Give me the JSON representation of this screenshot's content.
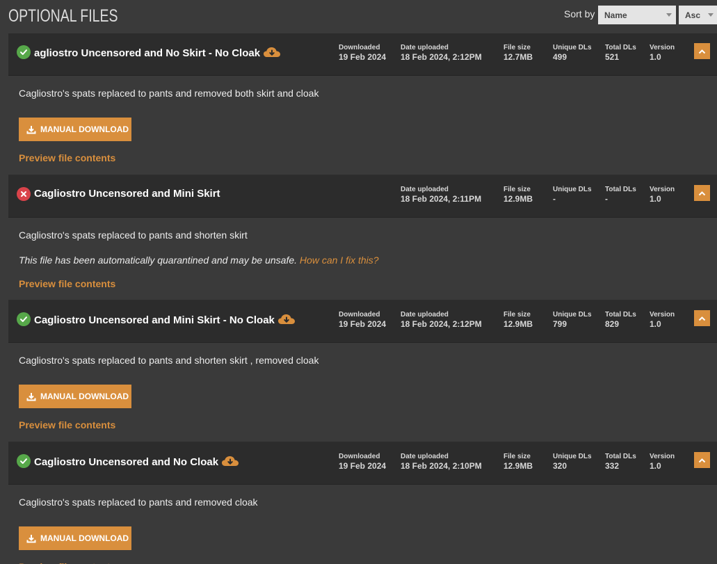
{
  "header": {
    "title": "OPTIONAL FILES",
    "sort_label": "Sort by",
    "sort_field": "Name",
    "sort_order": "Asc"
  },
  "labels": {
    "downloaded": "Downloaded",
    "date_uploaded": "Date uploaded",
    "file_size": "File size",
    "unique_dls": "Unique DLs",
    "total_dls": "Total DLs",
    "version": "Version",
    "manual_download": "MANUAL DOWNLOAD",
    "preview": "Preview file contents",
    "quarantine_text": "This file has been automatically quarantined and may be unsafe.",
    "quarantine_link": "How can I fix this?"
  },
  "colors": {
    "accent": "#d98f3d",
    "ok": "#57a84a",
    "error": "#d9434a",
    "header_bg": "#2c2c2c",
    "page_bg": "#3a3a3a"
  },
  "files": [
    {
      "title": "agliostro Uncensored and No Skirt - No Cloak",
      "status": "ok",
      "downloaded": "19 Feb 2024",
      "date_uploaded": "18 Feb 2024, 2:12PM",
      "file_size": "12.7MB",
      "unique_dls": "499",
      "total_dls": "521",
      "version": "1.0",
      "description": "Cagliostro's spats replaced to pants and removed both skirt and cloak"
    },
    {
      "title": "Cagliostro Uncensored and Mini Skirt",
      "status": "quarantined",
      "date_uploaded": "18 Feb 2024, 2:11PM",
      "file_size": "12.9MB",
      "unique_dls": "-",
      "total_dls": "-",
      "version": "1.0",
      "description": "Cagliostro's spats replaced to pants and shorten skirt"
    },
    {
      "title": "Cagliostro Uncensored and Mini Skirt - No Cloak",
      "status": "ok",
      "downloaded": "19 Feb 2024",
      "date_uploaded": "18 Feb 2024, 2:12PM",
      "file_size": "12.9MB",
      "unique_dls": "799",
      "total_dls": "829",
      "version": "1.0",
      "description": "Cagliostro's spats replaced to pants and shorten skirt , removed cloak"
    },
    {
      "title": "Cagliostro Uncensored and No Cloak",
      "status": "ok",
      "downloaded": "19 Feb 2024",
      "date_uploaded": "18 Feb 2024, 2:10PM",
      "file_size": "12.9MB",
      "unique_dls": "320",
      "total_dls": "332",
      "version": "1.0",
      "description": "Cagliostro's spats replaced to pants and removed cloak"
    }
  ]
}
